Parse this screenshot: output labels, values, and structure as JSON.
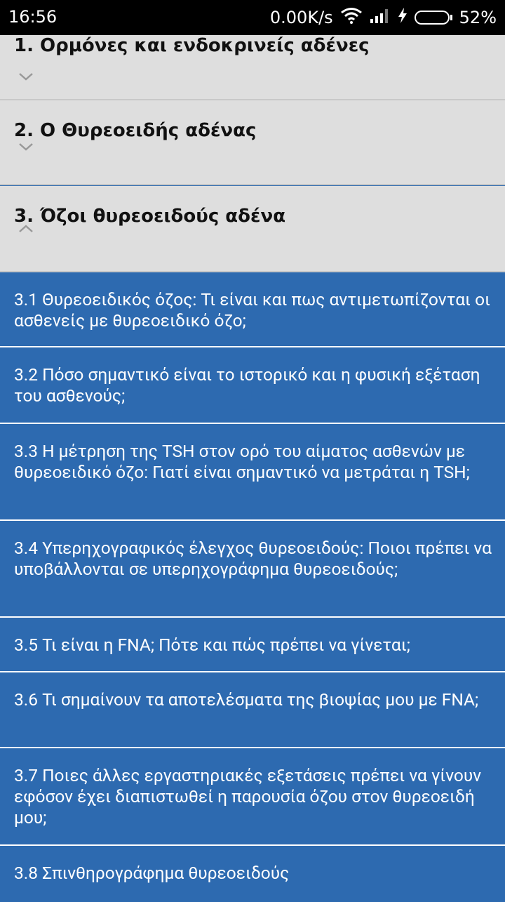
{
  "status_bar": {
    "time": "16:56",
    "network_speed": "0.00K/s",
    "battery_percent": "52%",
    "battery_level": 0.52,
    "icons": [
      "wifi-icon",
      "signal-icon",
      "charging-icon",
      "battery-icon"
    ],
    "battery_color": "#2ecc40"
  },
  "groups": [
    {
      "title": "1. Ορμόνες και ενδοκρινείς αδένες",
      "expanded": false
    },
    {
      "title": "2. Ο Θυρεοειδής αδένας",
      "expanded": false
    },
    {
      "title": "3. Όζοι θυρεοειδούς αδένα",
      "expanded": true
    }
  ],
  "items": [
    {
      "text": "3.1 Θυρεοειδικός όζος: Τι είναι και πως αντιμετωπίζονται οι ασθενείς με θυρεοειδικό όζο;"
    },
    {
      "text": "3.2 Πόσο σημαντικό είναι το ιστορικό και η φυσική εξέταση του ασθενούς;"
    },
    {
      "text": "3.3 Η μέτρηση της TSH στον ορό του αίματος ασθενών με θυρεοειδικό όζο: Γιατί είναι σημαντικό να μετράται η TSH;"
    },
    {
      "text": "3.4 Υπερηχογραφικός έλεγχος θυρεοειδούς: Ποιοι πρέπει να υποβάλλονται σε υπερηχογράφημα θυρεοειδούς;"
    },
    {
      "text": "3.5 Τι είναι η FNA; Πότε και πώς πρέπει να γίνεται;"
    },
    {
      "text": "3.6 Τι σημαίνουν τα αποτελέσματα της βιοψίας μου με FNA;"
    },
    {
      "text": "3.7 Ποιες άλλες εργαστηριακές εξετάσεις πρέπει να γίνουν εφόσον έχει διαπιστωθεί η παρουσία όζου στον θυρεοειδή μου;"
    },
    {
      "text": "3.8 Σπινθηρογράφημα θυρεοειδούς"
    }
  ],
  "colors": {
    "header_bg": "#dedede",
    "list_bg": "#2d6ab0",
    "item_text": "#ffffff"
  }
}
